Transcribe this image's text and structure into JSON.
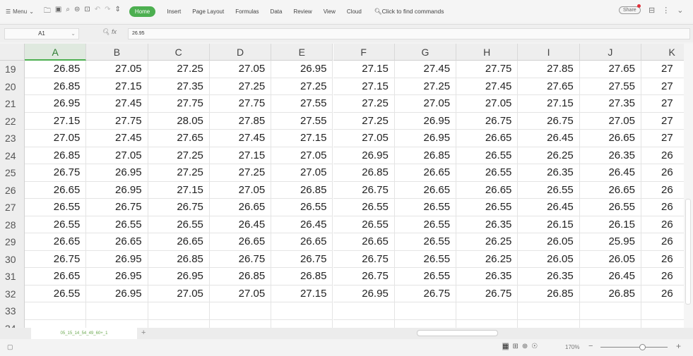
{
  "toolbar": {
    "menu": "Menu",
    "tabs": [
      "Home",
      "Insert",
      "Page Layout",
      "Formulas",
      "Data",
      "Review",
      "View",
      "Cloud"
    ],
    "find": "Click to find commands",
    "share": "Share"
  },
  "formula_bar": {
    "cell_ref": "A1",
    "fx": "fx",
    "value": "26.95"
  },
  "columns": [
    "A",
    "B",
    "C",
    "D",
    "E",
    "F",
    "G",
    "H",
    "I",
    "J",
    "K"
  ],
  "rows": [
    {
      "n": "19",
      "v": [
        "26.85",
        "27.05",
        "27.25",
        "27.05",
        "26.95",
        "27.15",
        "27.45",
        "27.75",
        "27.85",
        "27.65",
        "27"
      ]
    },
    {
      "n": "20",
      "v": [
        "26.85",
        "27.15",
        "27.35",
        "27.25",
        "27.25",
        "27.15",
        "27.25",
        "27.45",
        "27.65",
        "27.55",
        "27"
      ]
    },
    {
      "n": "21",
      "v": [
        "26.95",
        "27.45",
        "27.75",
        "27.75",
        "27.55",
        "27.25",
        "27.05",
        "27.05",
        "27.15",
        "27.35",
        "27"
      ]
    },
    {
      "n": "22",
      "v": [
        "27.15",
        "27.75",
        "28.05",
        "27.85",
        "27.55",
        "27.25",
        "26.95",
        "26.75",
        "26.75",
        "27.05",
        "27"
      ]
    },
    {
      "n": "23",
      "v": [
        "27.05",
        "27.45",
        "27.65",
        "27.45",
        "27.15",
        "27.05",
        "26.95",
        "26.65",
        "26.45",
        "26.65",
        "27"
      ]
    },
    {
      "n": "24",
      "v": [
        "26.85",
        "27.05",
        "27.25",
        "27.15",
        "27.05",
        "26.95",
        "26.85",
        "26.55",
        "26.25",
        "26.35",
        "26"
      ]
    },
    {
      "n": "25",
      "v": [
        "26.75",
        "26.95",
        "27.25",
        "27.25",
        "27.05",
        "26.85",
        "26.65",
        "26.55",
        "26.35",
        "26.45",
        "26"
      ]
    },
    {
      "n": "26",
      "v": [
        "26.65",
        "26.95",
        "27.15",
        "27.05",
        "26.85",
        "26.75",
        "26.65",
        "26.65",
        "26.55",
        "26.65",
        "26"
      ]
    },
    {
      "n": "27",
      "v": [
        "26.55",
        "26.75",
        "26.75",
        "26.65",
        "26.55",
        "26.55",
        "26.55",
        "26.55",
        "26.45",
        "26.55",
        "26"
      ]
    },
    {
      "n": "28",
      "v": [
        "26.55",
        "26.55",
        "26.55",
        "26.45",
        "26.45",
        "26.55",
        "26.55",
        "26.35",
        "26.15",
        "26.15",
        "26"
      ]
    },
    {
      "n": "29",
      "v": [
        "26.65",
        "26.65",
        "26.65",
        "26.65",
        "26.65",
        "26.65",
        "26.55",
        "26.25",
        "26.05",
        "25.95",
        "26"
      ]
    },
    {
      "n": "30",
      "v": [
        "26.75",
        "26.95",
        "26.85",
        "26.75",
        "26.75",
        "26.75",
        "26.55",
        "26.25",
        "26.05",
        "26.05",
        "26"
      ]
    },
    {
      "n": "31",
      "v": [
        "26.65",
        "26.95",
        "26.95",
        "26.85",
        "26.85",
        "26.75",
        "26.55",
        "26.35",
        "26.35",
        "26.45",
        "26"
      ]
    },
    {
      "n": "32",
      "v": [
        "26.55",
        "26.95",
        "27.05",
        "27.05",
        "27.15",
        "26.95",
        "26.75",
        "26.75",
        "26.85",
        "26.85",
        "26"
      ]
    },
    {
      "n": "33",
      "v": [
        "",
        "",
        "",
        "",
        "",
        "",
        "",
        "",
        "",
        "",
        ""
      ]
    },
    {
      "n": "34",
      "v": [
        "",
        "",
        "",
        "",
        "",
        "",
        "",
        "",
        "",
        "",
        ""
      ]
    }
  ],
  "sheet_tab": "05_15_14_54_49_60+_1",
  "status": {
    "zoom": "170%"
  },
  "colors": {
    "accent": "#4caf50"
  }
}
